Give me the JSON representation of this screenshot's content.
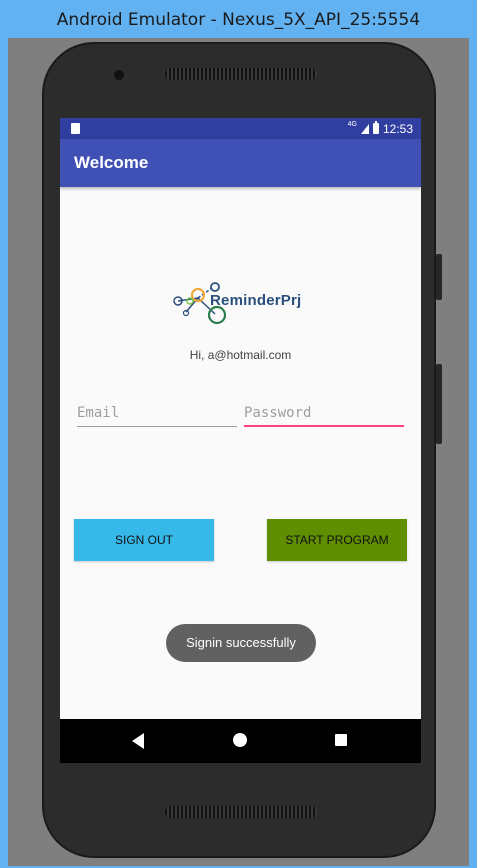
{
  "window": {
    "title": "Android Emulator - Nexus_5X_API_25:5554"
  },
  "statusbar": {
    "network": "4G",
    "time": "12:53"
  },
  "appbar": {
    "title": "Welcome"
  },
  "logo": {
    "text": "ReminderPrj"
  },
  "greeting": "Hi, a@hotmail.com",
  "form": {
    "email_placeholder": "Email",
    "email_value": "",
    "password_placeholder": "Password",
    "password_value": ""
  },
  "buttons": {
    "sign_out": "SIGN OUT",
    "start_program": "START PROGRAM"
  },
  "toast": "Signin successfully",
  "colors": {
    "primary": "#3f51b5",
    "primary_dark": "#303f9f",
    "accent": "#ff4081",
    "sign_out_button": "#36b8e8",
    "start_button": "#5f8f00"
  }
}
